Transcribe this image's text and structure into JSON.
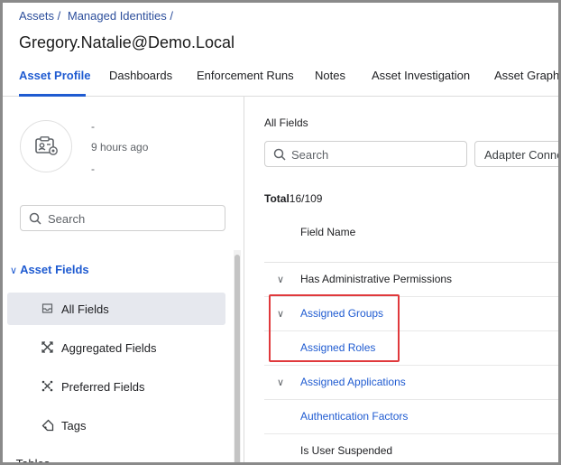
{
  "breadcrumb": {
    "items": [
      "Assets /",
      "Managed Identities /"
    ]
  },
  "page_title": "Gregory.Natalie@Demo.Local",
  "tabs": [
    {
      "label": "Asset Profile",
      "active": true
    },
    {
      "label": "Dashboards"
    },
    {
      "label": "Enforcement Runs"
    },
    {
      "label": "Notes"
    },
    {
      "label": "Asset Investigation"
    },
    {
      "label": "Asset Graph"
    }
  ],
  "profile": {
    "icon": "id-card-gear-icon",
    "name": "-",
    "last_seen": "9 hours ago",
    "extra": "-"
  },
  "left_search": {
    "placeholder": "Search"
  },
  "asset_fields": {
    "header": "Asset Fields",
    "items": [
      {
        "label": "All Fields",
        "icon": "inbox-icon",
        "selected": true
      },
      {
        "label": "Aggregated Fields",
        "icon": "aggregate-icon"
      },
      {
        "label": "Preferred Fields",
        "icon": "preferred-icon"
      },
      {
        "label": "Tags",
        "icon": "tag-icon"
      }
    ]
  },
  "tables_header": "Tables",
  "right": {
    "section_title": "All Fields",
    "search_placeholder": "Search",
    "adapter_filter": "Adapter Connections",
    "total_label": "Total",
    "total_value": "16/109",
    "column_header": "Field Name",
    "rows": [
      {
        "name": "Has Administrative Permissions",
        "expandable": true,
        "link": false
      },
      {
        "name": "Assigned Groups",
        "expandable": true,
        "link": true
      },
      {
        "name": "Assigned Roles",
        "expandable": false,
        "link": true
      },
      {
        "name": "Assigned Applications",
        "expandable": true,
        "link": true
      },
      {
        "name": "Authentication Factors",
        "expandable": false,
        "link": true
      },
      {
        "name": "Is User Suspended",
        "expandable": false,
        "link": false
      }
    ]
  },
  "colors": {
    "accent": "#1f5bd1",
    "highlight": "#e0393c",
    "selected_bg": "#e6e8ee"
  }
}
